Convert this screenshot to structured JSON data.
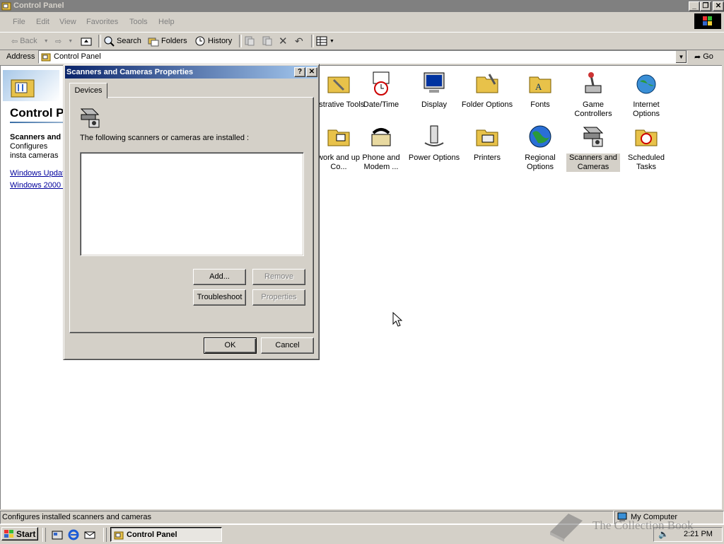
{
  "window": {
    "title": "Control Panel"
  },
  "menu": [
    "File",
    "Edit",
    "View",
    "Favorites",
    "Tools",
    "Help"
  ],
  "toolbar": {
    "back": "Back",
    "search": "Search",
    "folders": "Folders",
    "history": "History"
  },
  "address": {
    "label": "Address",
    "value": "Control Panel",
    "go": "Go"
  },
  "left_pane": {
    "title": "Control P",
    "selected_title": "Scanners and",
    "selected_desc": "Configures insta cameras",
    "links": [
      "Windows Updat",
      "Windows 2000 :"
    ]
  },
  "icons": [
    {
      "label": "nistrative Tools",
      "icon": "admin-tools-icon"
    },
    {
      "label": "Date/Time",
      "icon": "date-time-icon"
    },
    {
      "label": "Display",
      "icon": "display-icon"
    },
    {
      "label": "Folder Options",
      "icon": "folder-options-icon"
    },
    {
      "label": "Fonts",
      "icon": "fonts-icon"
    },
    {
      "label": "Game Controllers",
      "icon": "game-controllers-icon"
    },
    {
      "label": "Internet Options",
      "icon": "internet-options-icon"
    },
    {
      "label": "work and up Co...",
      "icon": "network-icon"
    },
    {
      "label": "Phone and Modem ...",
      "icon": "phone-modem-icon"
    },
    {
      "label": "Power Options",
      "icon": "power-options-icon"
    },
    {
      "label": "Printers",
      "icon": "printers-icon"
    },
    {
      "label": "Regional Options",
      "icon": "regional-options-icon"
    },
    {
      "label": "Scanners and Cameras",
      "icon": "scanners-cameras-icon"
    },
    {
      "label": "Scheduled Tasks",
      "icon": "scheduled-tasks-icon"
    }
  ],
  "dialog": {
    "title": "Scanners and Cameras Properties",
    "tab": "Devices",
    "installed_label": "The following scanners or cameras are installed :",
    "add": "Add...",
    "remove": "Remove",
    "troubleshoot": "Troubleshoot",
    "properties": "Properties",
    "ok": "OK",
    "cancel": "Cancel"
  },
  "status": {
    "text": "Configures installed scanners and cameras",
    "zone": "My Computer"
  },
  "taskbar": {
    "start": "Start",
    "task": "Control Panel",
    "time": "2:21 PM"
  },
  "watermark": "The Collection Book"
}
